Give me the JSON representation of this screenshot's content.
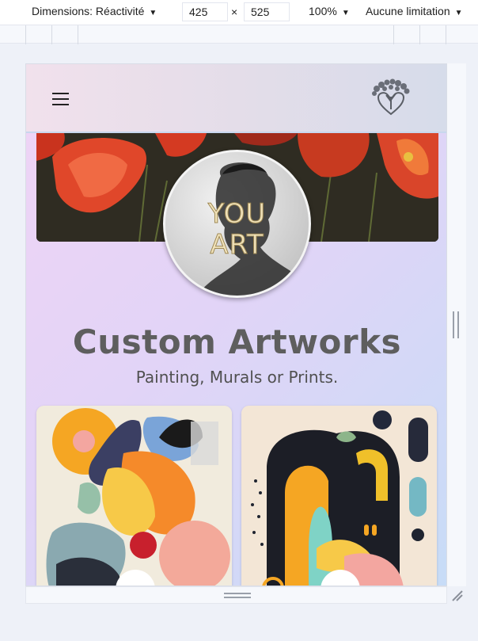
{
  "devtools": {
    "dimensions_label": "Dimensions: Réactivité",
    "width_value": "425",
    "height_value": "525",
    "times_symbol": "×",
    "zoom_label": "100%",
    "throttle_label": "Aucune limitation"
  },
  "site": {
    "avatar_line1": "YOU",
    "avatar_line2": "ART",
    "title": "Custom Artworks",
    "subtitle": "Painting, Murals or Prints."
  },
  "colors": {
    "title": "#5e5e5e",
    "header_bg": "#e4dde9",
    "page_gradient_start": "#f0d4f5",
    "page_gradient_end": "#c7dcf7"
  }
}
